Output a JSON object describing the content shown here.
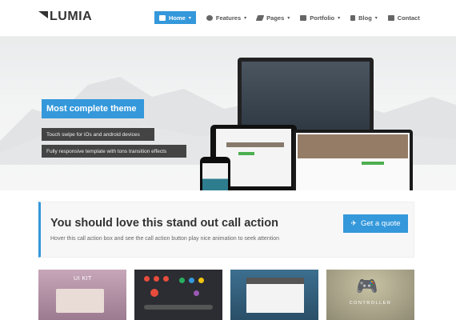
{
  "brand": {
    "name": "LUMIA"
  },
  "nav": {
    "items": [
      {
        "label": "Home",
        "icon": "home-icon",
        "caret": "▾",
        "active": true
      },
      {
        "label": "Features",
        "icon": "gear-icon",
        "caret": "▾"
      },
      {
        "label": "Pages",
        "icon": "pages-icon",
        "caret": "▾"
      },
      {
        "label": "Portfolio",
        "icon": "camera-icon",
        "caret": "▾"
      },
      {
        "label": "Blog",
        "icon": "book-icon",
        "caret": "▾"
      },
      {
        "label": "Contact",
        "icon": "mail-icon"
      }
    ]
  },
  "hero": {
    "title": "Most complete theme",
    "tags": [
      "Touch swipe for iOs and android devices",
      "Fully responsive template with tons transition effects"
    ]
  },
  "cta": {
    "title": "You should love this stand out call action",
    "subtitle": "Hover this call action box and see the call action button play nice animation to seek attention",
    "button_label": "Get a quote",
    "button_icon": "plane-icon"
  },
  "portfolio": {
    "items": [
      {
        "label": "UI KIT"
      },
      {
        "label": ""
      },
      {
        "label": ""
      },
      {
        "label": "CONTROLLER"
      }
    ]
  },
  "colors": {
    "accent": "#3498db",
    "dark": "#444444"
  }
}
